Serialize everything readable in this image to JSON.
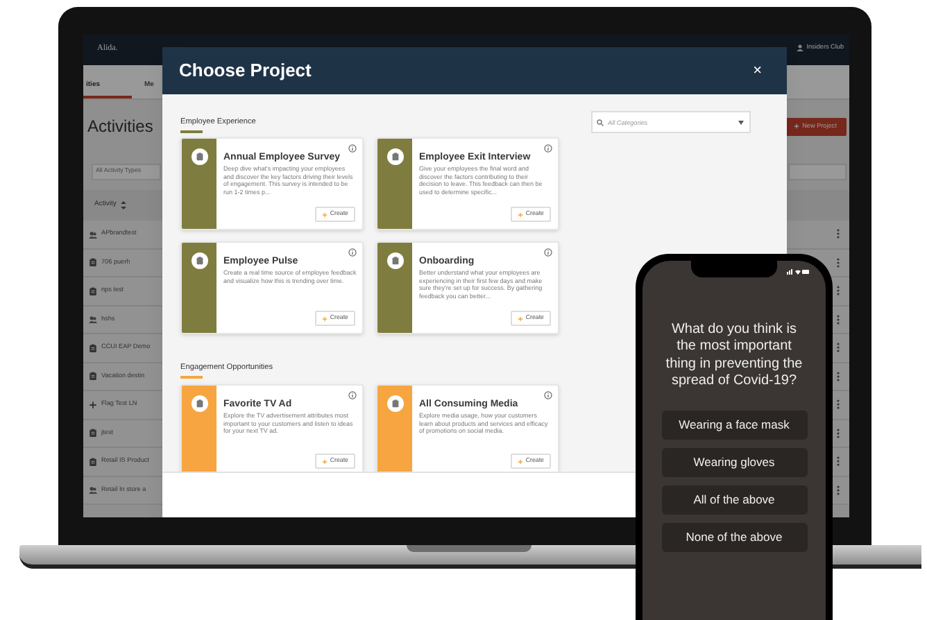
{
  "background_app": {
    "logo": "Alida.",
    "user": "Insiders Club",
    "tabs": [
      {
        "label": "ities",
        "selected": true
      },
      {
        "label": "Me",
        "selected": false
      }
    ],
    "title": "Activities",
    "new_project_button": "New Project",
    "filter": {
      "value": "All Activity Types"
    },
    "table": {
      "column": "Activity",
      "rows": [
        {
          "name": "APbrandtest",
          "kind": "group"
        },
        {
          "name": "706 puerh",
          "kind": "survey"
        },
        {
          "name": "nps test",
          "kind": "survey"
        },
        {
          "name": "hshs",
          "kind": "group"
        },
        {
          "name": "CCUI EAP Demo",
          "kind": "survey"
        },
        {
          "name": "Vacation destin",
          "kind": "survey"
        },
        {
          "name": "Flag Test LN",
          "kind": "flag"
        },
        {
          "name": "jtest",
          "kind": "survey"
        },
        {
          "name": "Retail IS Product",
          "kind": "survey"
        },
        {
          "name": "Retail In store a",
          "kind": "group"
        }
      ]
    }
  },
  "modal": {
    "title": "Choose Project",
    "close": "×",
    "search": {
      "placeholder": "All Categories"
    },
    "sections": [
      {
        "title": "Employee Experience",
        "color": "#7e7d3f",
        "cards": [
          {
            "title": "Annual Employee Survey",
            "description": "Deep dive what's impacting your employees and discover the key factors driving their levels of engagement. This survey is intended to be run 1-2 times p...",
            "button": "Create"
          },
          {
            "title": "Employee Exit Interview",
            "description": "Give your employees the final word and discover the factors contributing to their decision to leave. This feedback can then be used to determine specific...",
            "button": "Create"
          },
          {
            "title": "Employee Pulse",
            "description": "Create a real time source of employee feedback and visualize how this is trending over time.",
            "button": "Create"
          },
          {
            "title": "Onboarding",
            "description": "Better understand what your employees are experiencing in their first few days and make sure they're set up for success. By gathering feedback you can better...",
            "button": "Create"
          }
        ]
      },
      {
        "title": "Engagement Opportunities",
        "color": "#f6a540",
        "cards": [
          {
            "title": "Favorite TV Ad",
            "description": "Explore the TV advertisement attributes most important to your customers and listen to ideas for your next TV ad.",
            "button": "Create"
          },
          {
            "title": "All Consuming Media",
            "description": "Explore media usage, how your customers learn about products and services and efficacy of promotions on social media.",
            "button": "Create"
          }
        ]
      }
    ]
  },
  "phone": {
    "question": "What do you think is the most important thing in preventing the spread of Covid-19?",
    "options": [
      "Wearing a face mask",
      "Wearing gloves",
      "All of the above",
      "None of the above"
    ]
  }
}
